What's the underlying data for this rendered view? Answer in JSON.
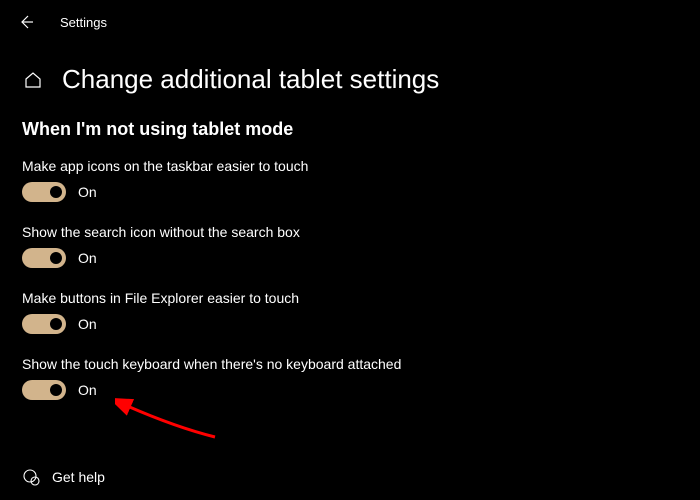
{
  "topbar": {
    "app_title": "Settings"
  },
  "header": {
    "page_title": "Change additional tablet settings"
  },
  "section": {
    "title": "When I'm not using tablet mode"
  },
  "settings": [
    {
      "label": "Make app icons on the taskbar easier to touch",
      "state": "On"
    },
    {
      "label": "Show the search icon without the search box",
      "state": "On"
    },
    {
      "label": "Make buttons in File Explorer easier to touch",
      "state": "On"
    },
    {
      "label": "Show the touch keyboard when there's no keyboard attached",
      "state": "On"
    }
  ],
  "footer": {
    "help_label": "Get help"
  },
  "colors": {
    "background": "#000000",
    "text": "#ffffff",
    "toggle_accent": "#d2b48c",
    "annotation_arrow": "#ff0000"
  }
}
